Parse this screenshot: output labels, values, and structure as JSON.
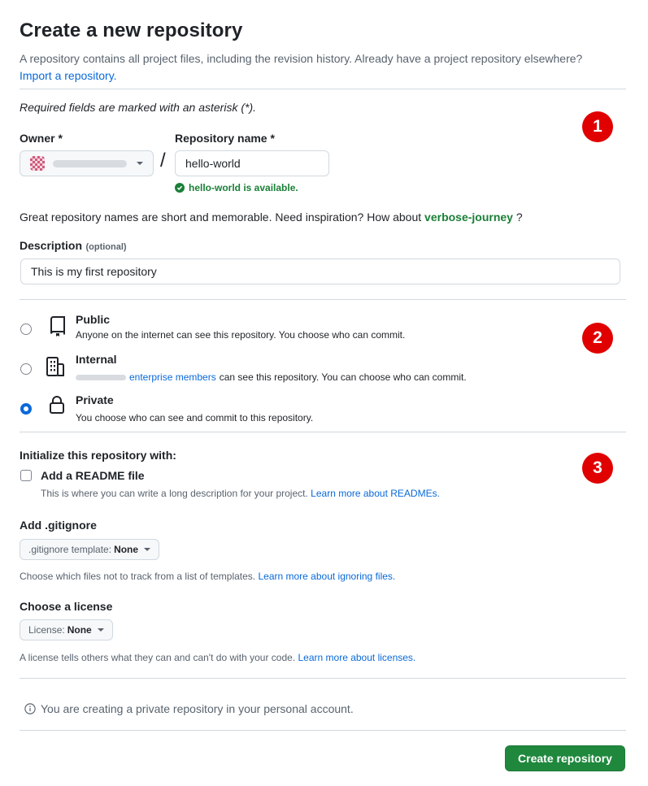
{
  "page": {
    "title": "Create a new repository",
    "intro": "A repository contains all project files, including the revision history. Already have a project repository elsewhere?",
    "import_link": "Import a repository.",
    "required_note": "Required fields are marked with an asterisk (*)."
  },
  "owner": {
    "label": "Owner *"
  },
  "repo": {
    "label": "Repository name *",
    "value": "hello-world",
    "available": "hello-world is available."
  },
  "inspiration": {
    "text": "Great repository names are short and memorable. Need inspiration? How about",
    "suggestion": "verbose-journey",
    "end": "?"
  },
  "description": {
    "label": "Description",
    "optional": "(optional)",
    "value": "This is my first repository"
  },
  "visibility": {
    "public": {
      "title": "Public",
      "desc": "Anyone on the internet can see this repository. You choose who can commit."
    },
    "internal": {
      "title": "Internal",
      "link": "enterprise members",
      "desc": "can see this repository. You can choose who can commit."
    },
    "private": {
      "title": "Private",
      "desc": "You choose who can see and commit to this repository."
    },
    "selected": "private"
  },
  "init": {
    "heading": "Initialize this repository with:",
    "readme_label": "Add a README file",
    "readme_desc": "This is where you can write a long description for your project.",
    "readme_link": "Learn more about READMEs."
  },
  "gitignore": {
    "heading": "Add .gitignore",
    "button_prefix": ".gitignore template:",
    "button_value": "None",
    "desc": "Choose which files not to track from a list of templates.",
    "link": "Learn more about ignoring files."
  },
  "license": {
    "heading": "Choose a license",
    "button_prefix": "License:",
    "button_value": "None",
    "desc": "A license tells others what they can and can't do with your code.",
    "link": "Learn more about licenses."
  },
  "notice": {
    "text": "You are creating a private repository in your personal account."
  },
  "submit": {
    "label": "Create repository"
  },
  "markers": [
    "1",
    "2",
    "3"
  ],
  "colors": {
    "accent": "#0969da",
    "success": "#1a7f37",
    "submit_bg": "#1f883d",
    "marker": "#e00000"
  }
}
